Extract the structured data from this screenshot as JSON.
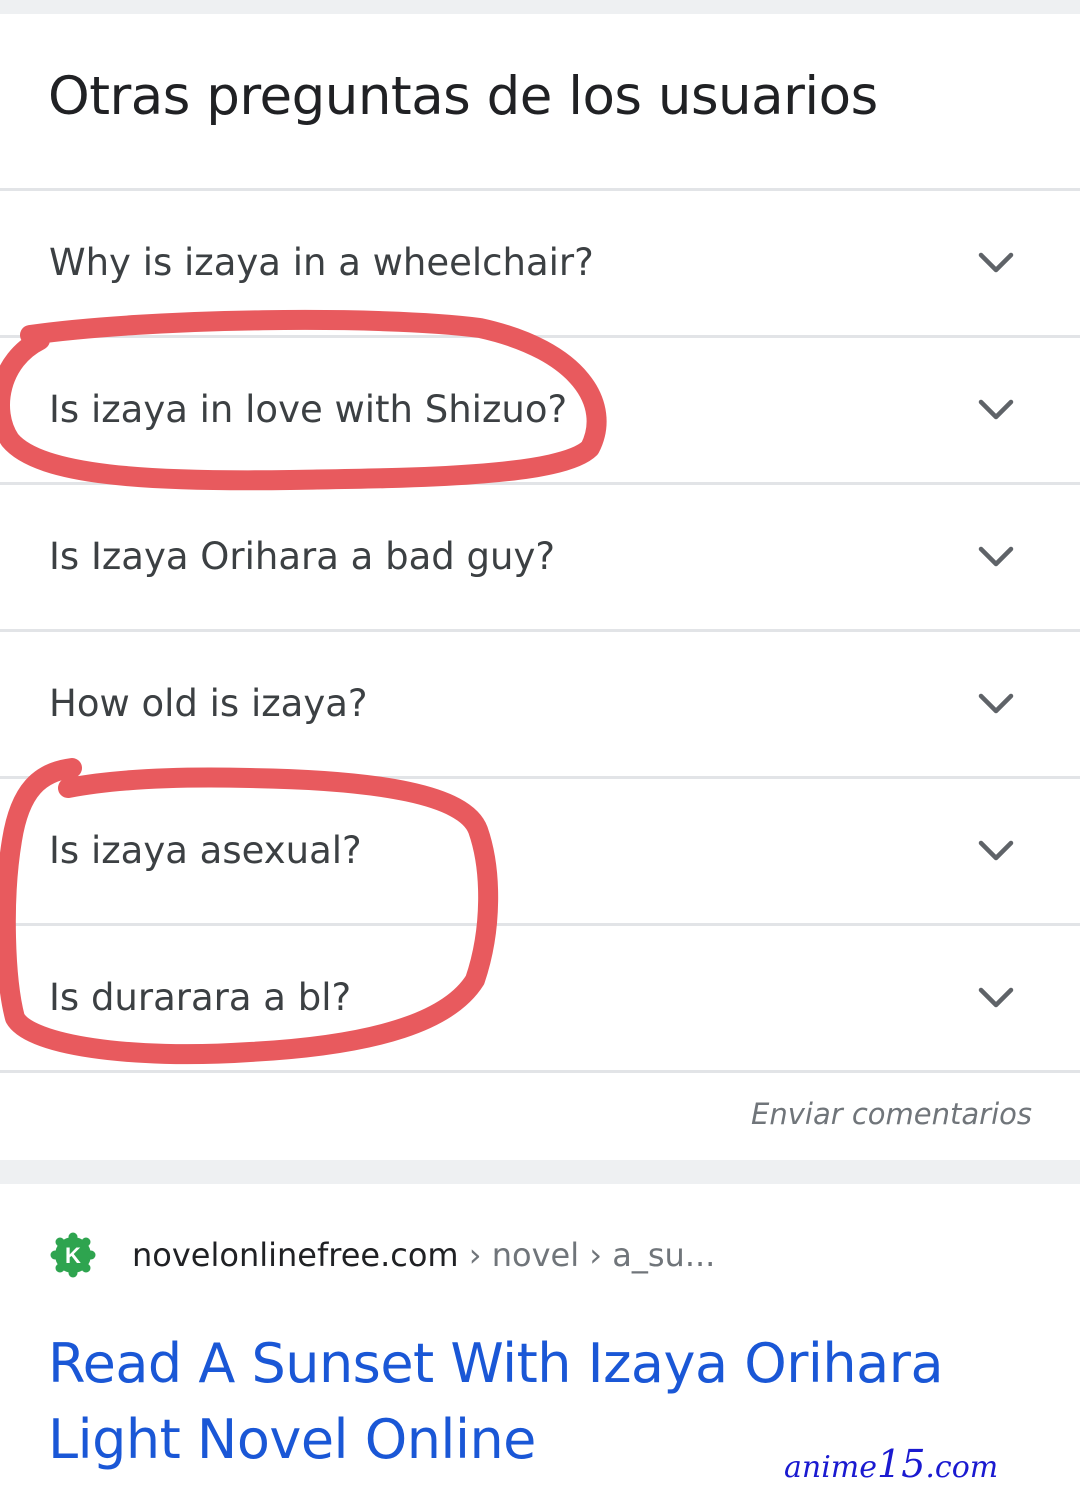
{
  "people_also_ask": {
    "title": "Otras preguntas de los usuarios",
    "questions": [
      "Why is izaya in a wheelchair?",
      "Is izaya in love with Shizuo?",
      "Is Izaya Orihara a bad guy?",
      "How old is izaya?",
      "Is izaya asexual?",
      "Is durarara a bl?"
    ],
    "expand_icon": "chevron-down-icon",
    "feedback_label": "Enviar comentarios"
  },
  "result": {
    "favicon_letter": "K",
    "favicon_color": "#2ea44f",
    "domain": "novelonlinefree.com",
    "path": " › novel › a_su...",
    "title": "Read A Sunset With Izaya Orihara Light Novel Online",
    "title_color": "#1a57d6"
  },
  "annotations": {
    "color": "#e85a5e",
    "circled_questions": [
      "Is izaya in love with Shizuo?",
      "Is izaya asexual?",
      "Is durarara a bl?"
    ]
  },
  "watermark": {
    "prefix": "anime",
    "number": "15",
    "suffix": ".com",
    "color": "#1a1ad0"
  }
}
